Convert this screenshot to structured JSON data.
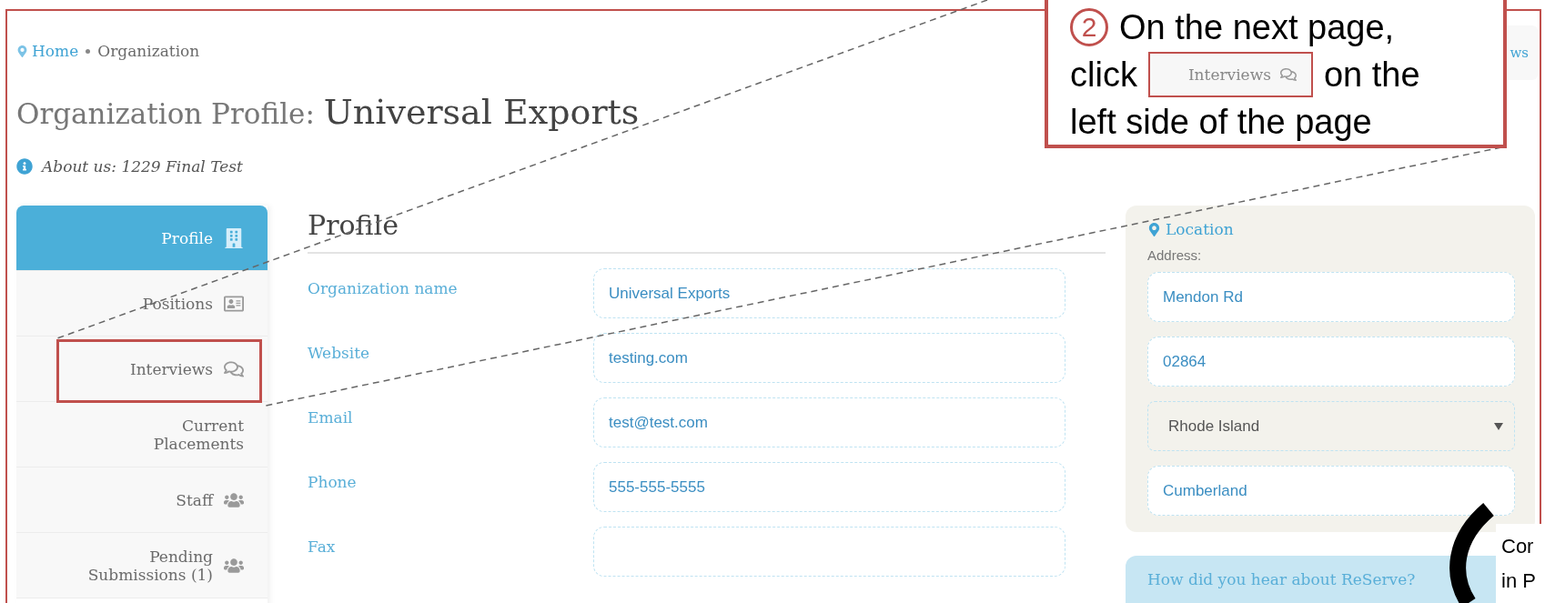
{
  "breadcrumb": [
    {
      "label": "Home",
      "kind": "link"
    },
    {
      "label": "Organization",
      "kind": "current"
    }
  ],
  "page_title": {
    "prefix": "Organization Profile:",
    "name": "Universal Exports"
  },
  "about": "About us: 1229 Final Test",
  "top_tab": {
    "label": "ws"
  },
  "sidebar": {
    "items": [
      {
        "label": "Profile",
        "kind": "building",
        "selected": true
      },
      {
        "label": "Positions",
        "kind": "card",
        "selected": false
      },
      {
        "label": "Interviews",
        "kind": "chat",
        "selected": false
      },
      {
        "label": "Current Placements",
        "kind": "plain",
        "selected": false
      },
      {
        "label": "Staff",
        "kind": "group",
        "selected": false
      },
      {
        "label": "Pending Submissions (1)",
        "kind": "group",
        "selected": false
      }
    ]
  },
  "profile": {
    "heading": "Profile",
    "fields": [
      {
        "label": "Organization name",
        "value": "Universal Exports"
      },
      {
        "label": "Website",
        "value": "testing.com"
      },
      {
        "label": "Email",
        "value": "test@test.com"
      },
      {
        "label": "Phone",
        "value": "555-555-5555"
      },
      {
        "label": "Fax"
      }
    ]
  },
  "location": {
    "title": "Location",
    "address_label": "Address:",
    "fields": [
      {
        "kind": "text",
        "value": "Mendon Rd"
      },
      {
        "kind": "text",
        "value": "02864"
      },
      {
        "kind": "select",
        "value": "Rhode Island"
      },
      {
        "kind": "text",
        "value": "Cumberland"
      }
    ]
  },
  "referral": {
    "title": "How did you hear about ReServe?"
  },
  "callout": {
    "step": "2",
    "line_1": "On the next page,",
    "before_button": "click",
    "button": "Interviews",
    "after_button": "on the",
    "line_3": "left side of the page"
  },
  "side_note": {
    "lines": [
      "Cor",
      "in P"
    ]
  }
}
